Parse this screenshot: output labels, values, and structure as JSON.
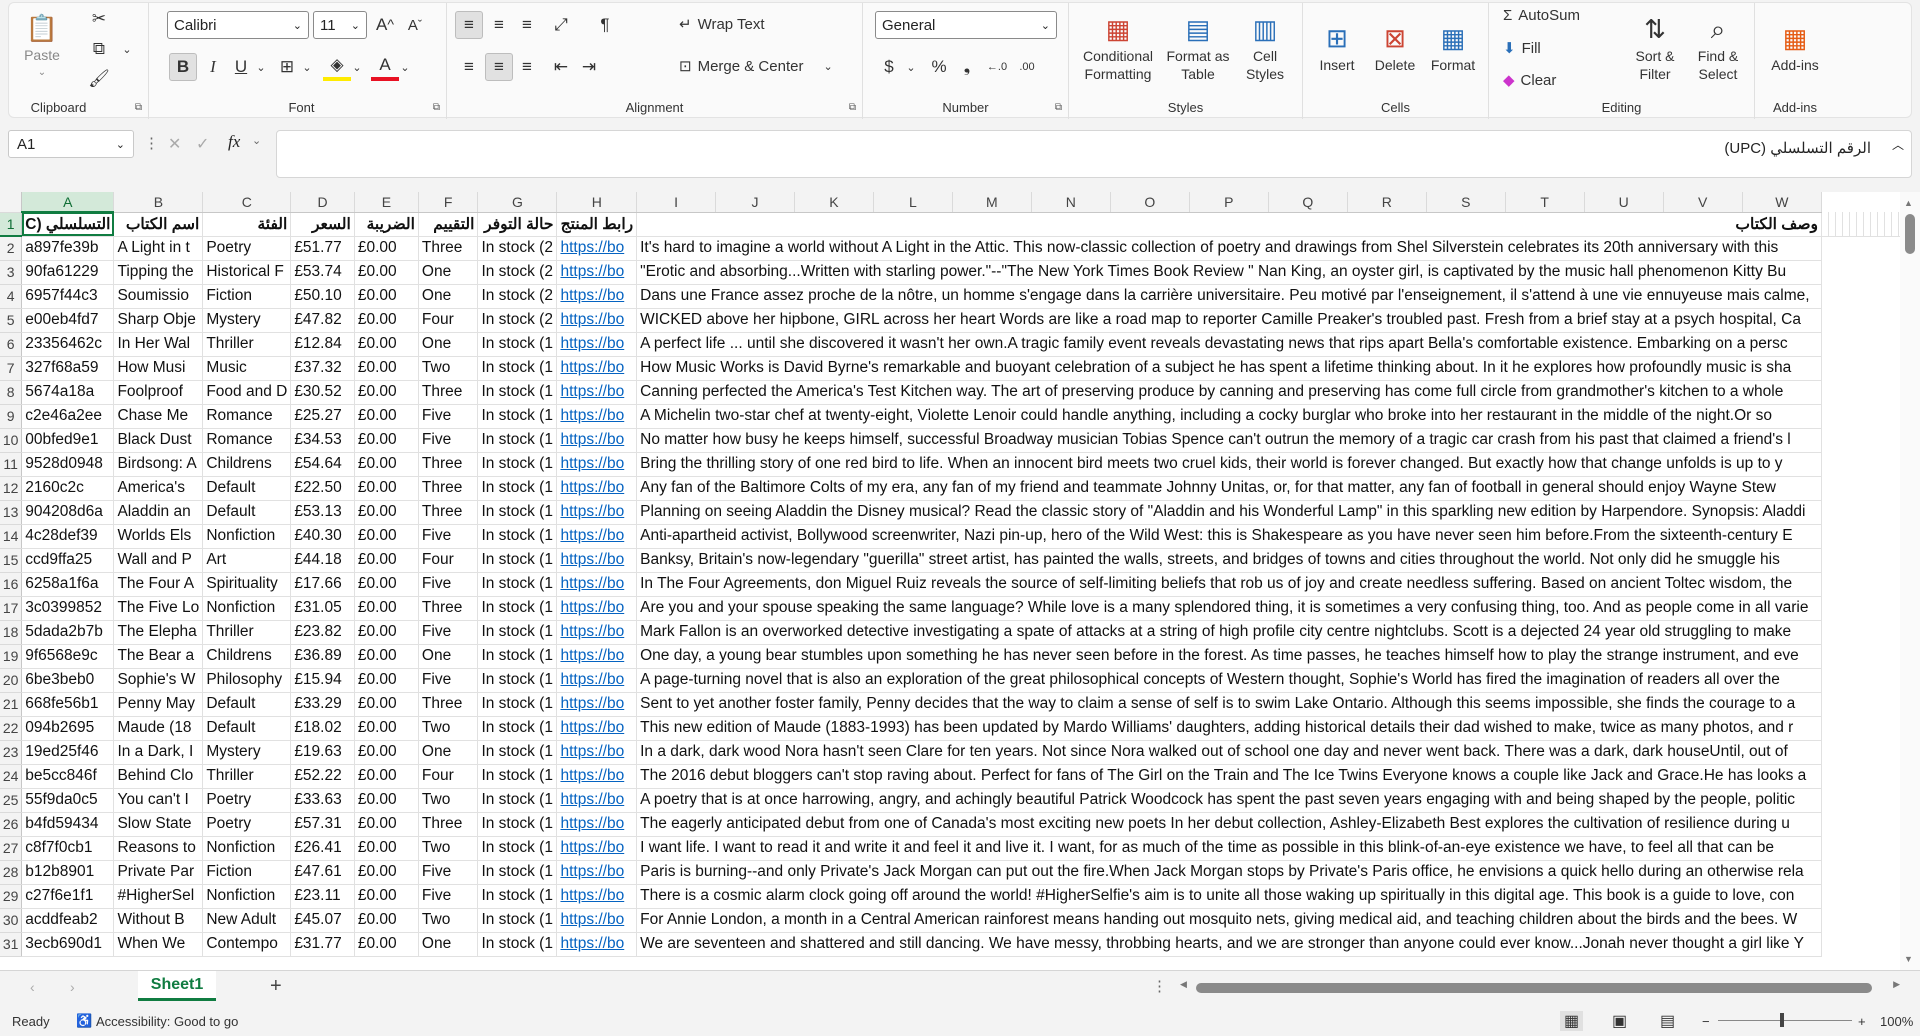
{
  "ribbon": {
    "clipboard": {
      "label": "Clipboard",
      "paste": "Paste"
    },
    "font": {
      "label": "Font",
      "name": "Calibri",
      "size": "11",
      "bold": "B",
      "italic": "I",
      "underline": "U"
    },
    "alignment": {
      "label": "Alignment",
      "wrap": "Wrap Text",
      "merge": "Merge & Center"
    },
    "number": {
      "label": "Number",
      "format": "General"
    },
    "styles": {
      "label": "Styles",
      "conditional": "Conditional Formatting",
      "format_table": "Format as Table",
      "cell_styles": "Cell Styles"
    },
    "cells": {
      "label": "Cells",
      "insert": "Insert",
      "delete": "Delete",
      "format": "Format"
    },
    "editing": {
      "label": "Editing",
      "autosum": "AutoSum",
      "fill": "Fill",
      "clear": "Clear",
      "sort": "Sort & Filter",
      "find": "Find & Select"
    },
    "addins": {
      "label": "Add-ins",
      "addins": "Add-ins"
    }
  },
  "formula": {
    "namebox": "A1",
    "content": "الرقم التسلسلي (UPC)"
  },
  "columns": [
    "A",
    "B",
    "C",
    "D",
    "E",
    "F",
    "G",
    "H",
    "I",
    "J",
    "K",
    "L",
    "M",
    "N",
    "O",
    "P",
    "Q",
    "R",
    "S",
    "T",
    "U",
    "V",
    "W"
  ],
  "header_row": [
    "التسلسلي (C",
    "اسم الكتاب",
    "الفئة",
    "السعر",
    "الضريبة",
    "التقييم",
    "حالة التوفر",
    "رابط المنتج",
    "وصف الكتاب"
  ],
  "rows": [
    [
      "a897fe39b",
      "A Light in t",
      "Poetry",
      "£51.77",
      "£0.00",
      "Three",
      "In stock (2",
      "https://bo",
      "It's hard to imagine a world without A Light in the Attic. This now-classic collection of poetry and drawings from Shel Silverstein celebrates its 20th anniversary with this"
    ],
    [
      "90fa61229",
      "Tipping the",
      "Historical F",
      "£53.74",
      "£0.00",
      "One",
      "In stock (2",
      "https://bo",
      "\"Erotic and absorbing...Written with starling power.\"--\"The New York Times Book Review \" Nan King, an oyster girl, is captivated by the music hall phenomenon Kitty Bu"
    ],
    [
      "6957f44c3",
      "Soumissio",
      "Fiction",
      "£50.10",
      "£0.00",
      "One",
      "In stock (2",
      "https://bo",
      "Dans une France assez proche de la nôtre, un homme s'engage dans la carrière universitaire. Peu motivé par l'enseignement, il s'attend à une vie ennuyeuse mais calme,"
    ],
    [
      "e00eb4fd7",
      "Sharp Obje",
      "Mystery",
      "£47.82",
      "£0.00",
      "Four",
      "In stock (2",
      "https://bo",
      "WICKED above her hipbone, GIRL across her heart Words are like a road map to reporter Camille Preaker's troubled past. Fresh from a brief stay at a psych hospital, Ca"
    ],
    [
      "23356462c",
      "In Her Wal",
      "Thriller",
      "£12.84",
      "£0.00",
      "One",
      "In stock (1",
      "https://bo",
      "A perfect life ... until she discovered it wasn't her own.A tragic family event reveals devastating news that rips apart Bella's comfortable existence. Embarking on a persc"
    ],
    [
      "327f68a59",
      "How Musi",
      "Music",
      "£37.32",
      "£0.00",
      "Two",
      "In stock (1",
      "https://bo",
      "How Music Works is David Byrne's remarkable and buoyant celebration of a subject he has spent a lifetime thinking about. In it he explores how profoundly music is sha"
    ],
    [
      "5674a18a",
      "Foolproof",
      "Food and D",
      "£30.52",
      "£0.00",
      "Three",
      "In stock (1",
      "https://bo",
      "Canning perfected the America's Test Kitchen way. The art of preserving produce by canning and preserving has come full circle from grandmother's kitchen to a whole"
    ],
    [
      "c2e46a2ee",
      "Chase Me",
      "Romance",
      "£25.27",
      "£0.00",
      "Five",
      "In stock (1",
      "https://bo",
      "A Michelin two-star chef at twenty-eight, Violette Lenoir could handle anything, including a cocky burglar who broke into her restaurant in the middle of the night.Or so"
    ],
    [
      "00bfed9e1",
      "Black Dust",
      "Romance",
      "£34.53",
      "£0.00",
      "Five",
      "In stock (1",
      "https://bo",
      "No matter how busy he keeps himself, successful Broadway musician Tobias Spence can't outrun the memory of a tragic car crash from his past that claimed a friend's l"
    ],
    [
      "9528d0948",
      "Birdsong: A",
      "Childrens",
      "£54.64",
      "£0.00",
      "Three",
      "In stock (1",
      "https://bo",
      "Bring the thrilling story of one red bird to life. When an innocent bird meets two cruel kids, their world is forever changed. But exactly how that change unfolds is up to y"
    ],
    [
      "2160c2c",
      "America's",
      "Default",
      "£22.50",
      "£0.00",
      "Three",
      "In stock (1",
      "https://bo",
      "Any fan of the Baltimore Colts of my era, any fan of my friend and teammate Johnny Unitas, or, for that matter, any fan of football in general should enjoy Wayne Stew"
    ],
    [
      "904208d6a",
      "Aladdin an",
      "Default",
      "£53.13",
      "£0.00",
      "Three",
      "In stock (1",
      "https://bo",
      "Planning on seeing Aladdin the Disney musical? Read the classic story of \"Aladdin and his Wonderful Lamp\" in this sparkling new edition by Harpendore. Synopsis: Aladdi"
    ],
    [
      "4c28def39",
      "Worlds Els",
      "Nonfiction",
      "£40.30",
      "£0.00",
      "Five",
      "In stock (1",
      "https://bo",
      "Anti-apartheid activist, Bollywood screenwriter, Nazi pin-up, hero of the Wild West: this is Shakespeare as you have never seen him before.From the sixteenth-century E"
    ],
    [
      "ccd9ffa25",
      "Wall and P",
      "Art",
      "£44.18",
      "£0.00",
      "Four",
      "In stock (1",
      "https://bo",
      "Banksy, Britain's now-legendary \"guerilla\" street artist, has painted the walls, streets, and bridges of towns and cities throughout the world. Not only did he smuggle his"
    ],
    [
      "6258a1f6a",
      "The Four A",
      "Spirituality",
      "£17.66",
      "£0.00",
      "Five",
      "In stock (1",
      "https://bo",
      "In The Four Agreements, don Miguel Ruiz reveals the source of self-limiting beliefs that rob us of joy and create needless suffering. Based on ancient Toltec wisdom, the"
    ],
    [
      "3c0399852",
      "The Five Lo",
      "Nonfiction",
      "£31.05",
      "£0.00",
      "Three",
      "In stock (1",
      "https://bo",
      "Are you and your spouse speaking the same language? While love is a many splendored thing, it is sometimes a very confusing thing, too. And as people come in all varie"
    ],
    [
      "5dada2b7b",
      "The Elepha",
      "Thriller",
      "£23.82",
      "£0.00",
      "Five",
      "In stock (1",
      "https://bo",
      "Mark Fallon is an overworked detective investigating a spate of attacks at a string of high profile city centre nightclubs. Scott is a dejected 24 year old struggling to make"
    ],
    [
      "9f6568e9c",
      "The Bear a",
      "Childrens",
      "£36.89",
      "£0.00",
      "One",
      "In stock (1",
      "https://bo",
      "One day, a young bear stumbles upon something he has never seen before in the forest. As time passes, he teaches himself how to play the strange instrument, and eve"
    ],
    [
      "6be3beb0",
      "Sophie's W",
      "Philosophy",
      "£15.94",
      "£0.00",
      "Five",
      "In stock (1",
      "https://bo",
      "A page-turning novel that is also an exploration of the great philosophical concepts of Western thought, Sophie's World has fired the imagination of readers all over the"
    ],
    [
      "668fe56b1",
      "Penny May",
      "Default",
      "£33.29",
      "£0.00",
      "Three",
      "In stock (1",
      "https://bo",
      "Sent to yet another foster family, Penny decides that the way to claim a sense of self is to swim Lake Ontario. Although this seems impossible, she finds the courage to a"
    ],
    [
      "094b2695",
      "Maude (18",
      "Default",
      "£18.02",
      "£0.00",
      "Two",
      "In stock (1",
      "https://bo",
      "This new edition of Maude (1883-1993) has been updated by Mardo Williams' daughters, adding historical details their dad wished to make, twice as many photos, and r"
    ],
    [
      "19ed25f46",
      "In a Dark, I",
      "Mystery",
      "£19.63",
      "£0.00",
      "One",
      "In stock (1",
      "https://bo",
      "In a dark, dark wood Nora hasn't seen Clare for ten years. Not since Nora walked out of school one day and never went back. There was a dark, dark houseUntil, out of"
    ],
    [
      "be5cc846f",
      "Behind Clo",
      "Thriller",
      "£52.22",
      "£0.00",
      "Four",
      "In stock (1",
      "https://bo",
      "The 2016 debut bloggers can't stop raving about. Perfect for fans of The Girl on the Train and The Ice Twins Everyone knows a couple like Jack and Grace.He has looks a"
    ],
    [
      "55f9da0c5",
      "You can't I",
      "Poetry",
      "£33.63",
      "£0.00",
      "Two",
      "In stock (1",
      "https://bo",
      "A poetry that is at once harrowing, angry, and achingly beautiful Patrick Woodcock has spent the past seven years engaging with and being shaped by the people, politic"
    ],
    [
      "b4fd59434",
      "Slow State",
      "Poetry",
      "£57.31",
      "£0.00",
      "Three",
      "In stock (1",
      "https://bo",
      "The eagerly anticipated debut from one of Canada's most exciting new poets In her debut collection, Ashley-Elizabeth Best explores the cultivation of resilience during u"
    ],
    [
      "c8f7f0cb1",
      "Reasons to",
      "Nonfiction",
      "£26.41",
      "£0.00",
      "Two",
      "In stock (1",
      "https://bo",
      "I want life. I want to read it and write it and feel it and live it. I want, for as much of the time as possible in this blink-of-an-eye existence we have, to feel all that can be"
    ],
    [
      "b12b8901",
      "Private Par",
      "Fiction",
      "£47.61",
      "£0.00",
      "Five",
      "In stock (1",
      "https://bo",
      "Paris is burning--and only Private's Jack Morgan can put out the fire.When Jack Morgan stops by Private's Paris office, he envisions a quick hello during an otherwise rela"
    ],
    [
      "c27f6e1f1",
      "#HigherSel",
      "Nonfiction",
      "£23.11",
      "£0.00",
      "Five",
      "In stock (1",
      "https://bo",
      "There is a cosmic alarm clock going off around the world! #HigherSelfie's aim is to unite all those waking up spiritually in this digital age. This book is a guide to love, con"
    ],
    [
      "acddfeab2",
      "Without B",
      "New Adult",
      "£45.07",
      "£0.00",
      "Two",
      "In stock (1",
      "https://bo",
      "For Annie London, a month in a Central American rainforest means handing out mosquito nets, giving medical aid, and teaching children about the birds and the bees. W"
    ],
    [
      "3ecb690d1",
      "When We",
      "Contempo",
      "£31.77",
      "£0.00",
      "One",
      "In stock (1",
      "https://bo",
      "We are seventeen and shattered and still dancing. We have messy, throbbing hearts, and we are stronger than anyone could ever know...Jonah never thought a girl like Y"
    ]
  ],
  "sheet_tab": "Sheet1",
  "status": {
    "ready": "Ready",
    "accessibility": "Accessibility: Good to go",
    "zoom": "100%"
  }
}
